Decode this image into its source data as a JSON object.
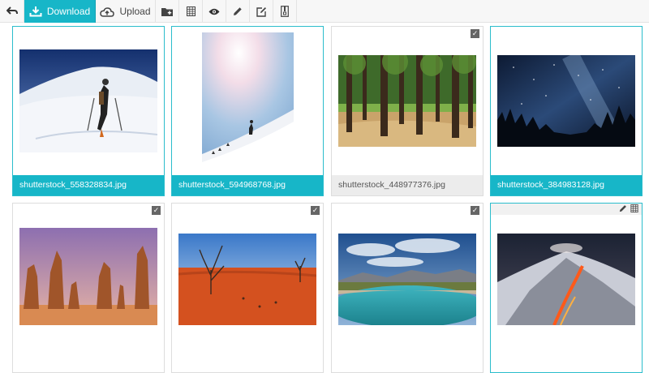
{
  "toolbar": {
    "back_icon": "back-arrow-icon",
    "download_label": "Download",
    "upload_label": "Upload",
    "icons": [
      "new-folder-icon",
      "grid-icon",
      "eye-icon",
      "pencil-icon",
      "edit-icon",
      "compress-icon"
    ],
    "accent": "#17b6c8"
  },
  "files": [
    {
      "name": "shutterstock_558328834.jpg",
      "selected": true
    },
    {
      "name": "shutterstock_594968768.jpg",
      "selected": true
    },
    {
      "name": "shutterstock_448977376.jpg",
      "selected": false,
      "checked": true
    },
    {
      "name": "shutterstock_384983128.jpg",
      "selected": true
    },
    {
      "name": "",
      "selected": false,
      "checked": true
    },
    {
      "name": "",
      "selected": false,
      "checked": true
    },
    {
      "name": "",
      "selected": false,
      "checked": true
    },
    {
      "name": "",
      "selected": true,
      "hover_icons": [
        "pencil-icon",
        "grid-icon"
      ]
    }
  ],
  "check_glyph": "✓"
}
